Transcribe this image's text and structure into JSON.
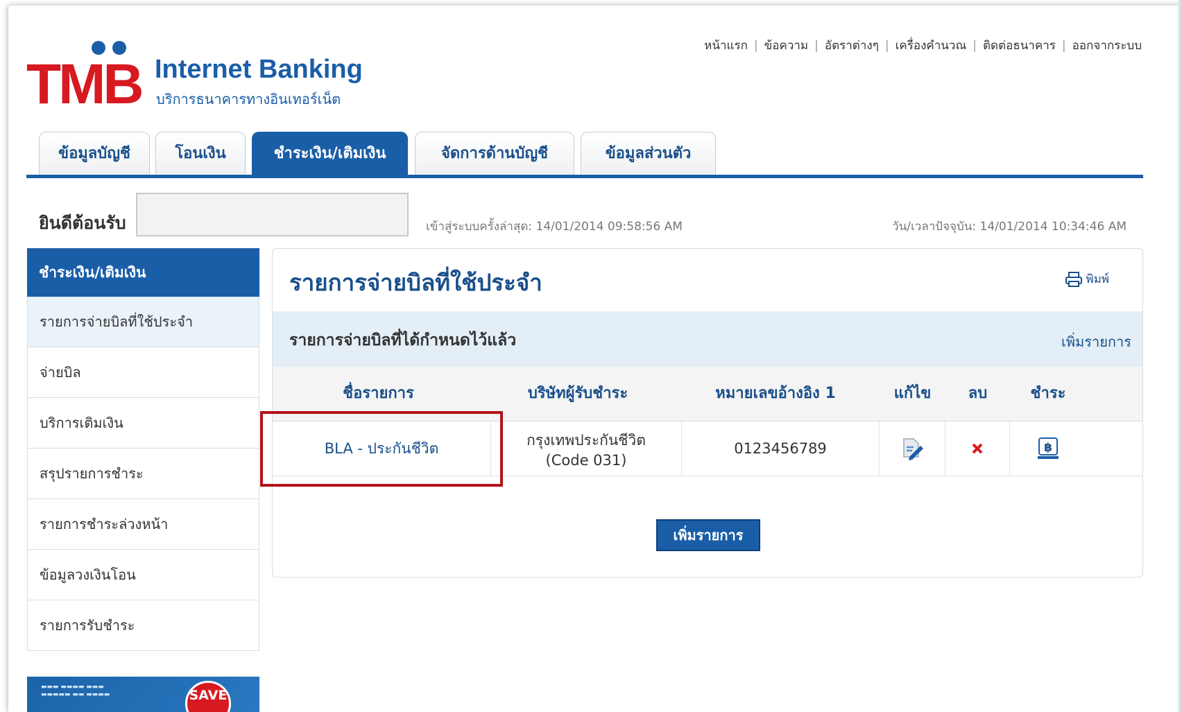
{
  "brand": {
    "logo_text": "TMB",
    "product": "Internet Banking",
    "product_sub": "บริการธนาคารทางอินเทอร์เน็ต"
  },
  "top_links": [
    "หน้าแรก",
    "ข้อความ",
    "อัตราต่างๆ",
    "เครื่องคำนวณ",
    "ติดต่อธนาคาร",
    "ออกจากระบบ"
  ],
  "tabs": [
    {
      "label": "ข้อมูลบัญชี"
    },
    {
      "label": "โอนเงิน"
    },
    {
      "label": "ชำระเงิน/เติมเงิน"
    },
    {
      "label": "จัดการด้านบัญชี"
    },
    {
      "label": "ข้อมูลส่วนตัว"
    }
  ],
  "active_tab": 2,
  "welcome": {
    "label": "ยินดีต้อนรับ",
    "last_login": "เข้าสู่ระบบครั้งล่าสุด: 14/01/2014 09:58:56 AM",
    "current_time": "วัน/เวลาปัจจุบัน: 14/01/2014 10:34:46 AM"
  },
  "sidebar": {
    "title": "ชำระเงิน/เติมเงิน",
    "items": [
      {
        "label": "รายการจ่ายบิลที่ใช้ประจำ"
      },
      {
        "label": "จ่ายบิล"
      },
      {
        "label": "บริการเติมเงิน"
      },
      {
        "label": "สรุปรายการชำระ"
      },
      {
        "label": "รายการชำระล่วงหน้า"
      },
      {
        "label": "ข้อมูลวงเงินโอน"
      },
      {
        "label": "รายการรับชำระ"
      }
    ],
    "promo_badge": "SAVE"
  },
  "main": {
    "title": "รายการจ่ายบิลที่ใช้ประจำ",
    "print_label": "พิมพ์",
    "subheader": "รายการจ่ายบิลที่ได้กำหนดไว้แล้ว",
    "add_link": "เพิ่มรายการ",
    "columns": [
      "ชื่อรายการ",
      "บริษัทผู้รับชำระ",
      "หมายเลขอ้างอิง 1",
      "แก้ไข",
      "ลบ",
      "ชำระ"
    ],
    "rows": [
      {
        "name": "BLA - ประกันชีวิต",
        "company": "กรุงเทพประกันชีวิต (Code 031)",
        "ref1": "0123456789"
      }
    ],
    "add_button": "เพิ่มรายการ"
  },
  "colors": {
    "brand_blue": "#1a5ea8",
    "brand_red": "#d71920",
    "highlight_red": "#b3121a"
  }
}
